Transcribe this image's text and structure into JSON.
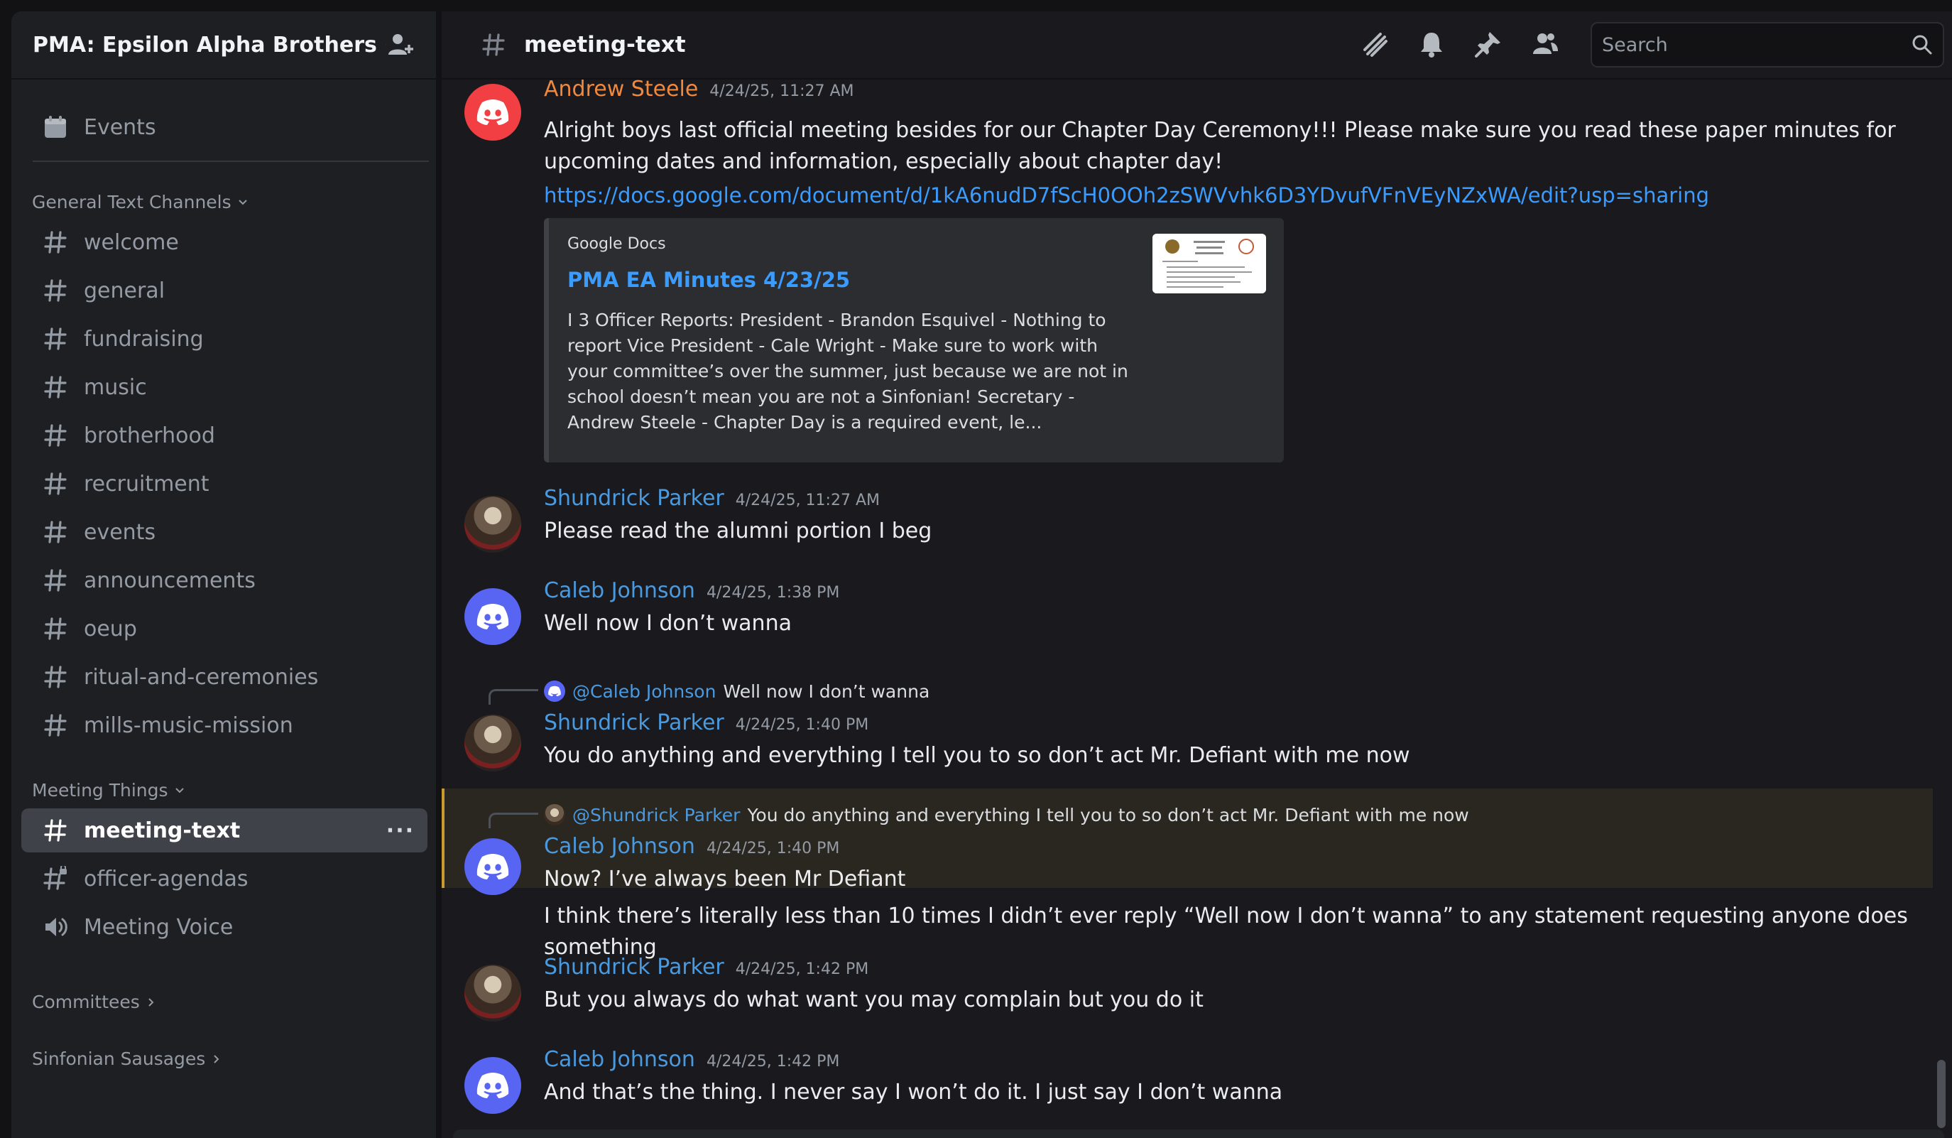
{
  "server": {
    "name": "PMA: Epsilon Alpha Brothers"
  },
  "sidebar": {
    "events_label": "Events",
    "categories": [
      {
        "name": "General Text Channels",
        "channels": [
          "welcome",
          "general",
          "fundraising",
          "music",
          "brotherhood",
          "recruitment",
          "events",
          "announcements",
          "oeup",
          "ritual-and-ceremonies",
          "mills-music-mission"
        ]
      },
      {
        "name": "Meeting Things",
        "channels": [
          "meeting-text",
          "officer-agendas",
          "Meeting Voice"
        ]
      },
      {
        "name": "Committees"
      },
      {
        "name": "Sinfonian Sausages"
      }
    ],
    "active_channel": "meeting-text",
    "active_more": "···"
  },
  "topbar": {
    "channel": "meeting-text",
    "search_placeholder": "Search"
  },
  "messages": [
    {
      "author": "Andrew Steele",
      "timestamp": "4/24/25, 11:27 AM",
      "text": "Alright boys last official meeting besides for our Chapter Day Ceremony!!! Please make sure you read these paper minutes for upcoming dates and information, especially about chapter day!",
      "link": "https://docs.google.com/document/d/1kA6nudD7fScH0OOh2zSWVvhk6D3YDvufVFnVEyNZxWA/edit?usp=sharing",
      "embed": {
        "provider": "Google Docs",
        "title": "PMA EA Minutes 4/23/25",
        "description": "I 3 Officer Reports: President - Brandon Esquivel - Nothing to report Vice President - Cale Wright - Make sure to work with your committee’s over the summer, just because we are not in school doesn’t mean you are not a Sinfonian! Secretary - Andrew Steele - Chapter Day is a required event, le..."
      }
    },
    {
      "author": "Shundrick Parker",
      "timestamp": "4/24/25, 11:27 AM",
      "text": "Please read the alumni portion I beg"
    },
    {
      "author": "Caleb Johnson",
      "timestamp": "4/24/25, 1:38 PM",
      "text": "Well now I don’t wanna"
    },
    {
      "reply_mention": "@Caleb Johnson",
      "reply_text": "Well now I don’t wanna",
      "author": "Shundrick Parker",
      "timestamp": "4/24/25, 1:40 PM",
      "text": "You do anything and everything I tell you to so don’t act Mr. Defiant with me now"
    },
    {
      "reply_mention": "@Shundrick Parker",
      "reply_text": "You do anything and everything I tell you to so don’t act Mr. Defiant with me now",
      "author": "Caleb Johnson",
      "timestamp": "4/24/25, 1:40 PM",
      "text": "Now? I’ve always been Mr Defiant",
      "text2": "I think there’s literally less than 10 times I didn’t ever reply “Well now I don’t wanna” to any statement requesting anyone does something"
    },
    {
      "author": "Shundrick Parker",
      "timestamp": "4/24/25, 1:42 PM",
      "text": "But you always do what want you may complain but you do it"
    },
    {
      "author": "Caleb Johnson",
      "timestamp": "4/24/25, 1:42 PM",
      "text": "And that’s the thing. I never say I won’t do it. I just say I don’t wanna"
    }
  ],
  "colors": {
    "accent_link": "#3a9cff",
    "author_orange": "#f0883e",
    "author_blue": "#4a9ae0",
    "avatar_red": "#f23f43",
    "avatar_blurple": "#5865f2",
    "highlight_bar": "#c99a2e"
  },
  "icons": [
    "server-chevron-icon",
    "add-member-icon",
    "calendar-icon",
    "hash-icon",
    "speaker-icon",
    "threads-icon",
    "bell-icon",
    "pin-icon",
    "members-icon",
    "search-icon",
    "discord-logo-icon"
  ]
}
